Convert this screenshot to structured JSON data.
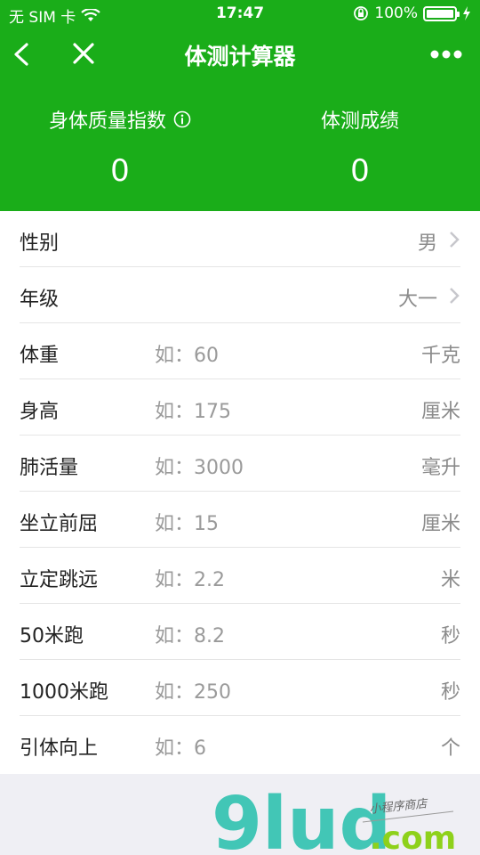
{
  "status": {
    "carrier": "无 SIM 卡",
    "time": "17:47",
    "battery": "100%"
  },
  "nav": {
    "title": "体测计算器"
  },
  "summary": {
    "bmi_label": "身体质量指数",
    "bmi_value": "0",
    "score_label": "体测成绩",
    "score_value": "0"
  },
  "fields": [
    {
      "label": "性别",
      "value": "男"
    },
    {
      "label": "年级",
      "value": "大一"
    },
    {
      "label": "体重",
      "placeholder": "如：60",
      "unit": "千克"
    },
    {
      "label": "身高",
      "placeholder": "如：175",
      "unit": "厘米"
    },
    {
      "label": "肺活量",
      "placeholder": "如：3000",
      "unit": "毫升"
    },
    {
      "label": "坐立前屈",
      "placeholder": "如：15",
      "unit": "厘米"
    },
    {
      "label": "立定跳远",
      "placeholder": "如：2.2",
      "unit": "米"
    },
    {
      "label": "50米跑",
      "placeholder": "如：8.2",
      "unit": "秒"
    },
    {
      "label": "1000米跑",
      "placeholder": "如：250",
      "unit": "秒"
    },
    {
      "label": "引体向上",
      "placeholder": "如：6",
      "unit": "个"
    }
  ],
  "watermark": {
    "brand": "9lud",
    "tagline": "小程序商店",
    "domain": ".com"
  },
  "colors": {
    "primary": "#1aad19",
    "watermark_teal": "#30c2b0",
    "watermark_green": "#8ed11b"
  }
}
